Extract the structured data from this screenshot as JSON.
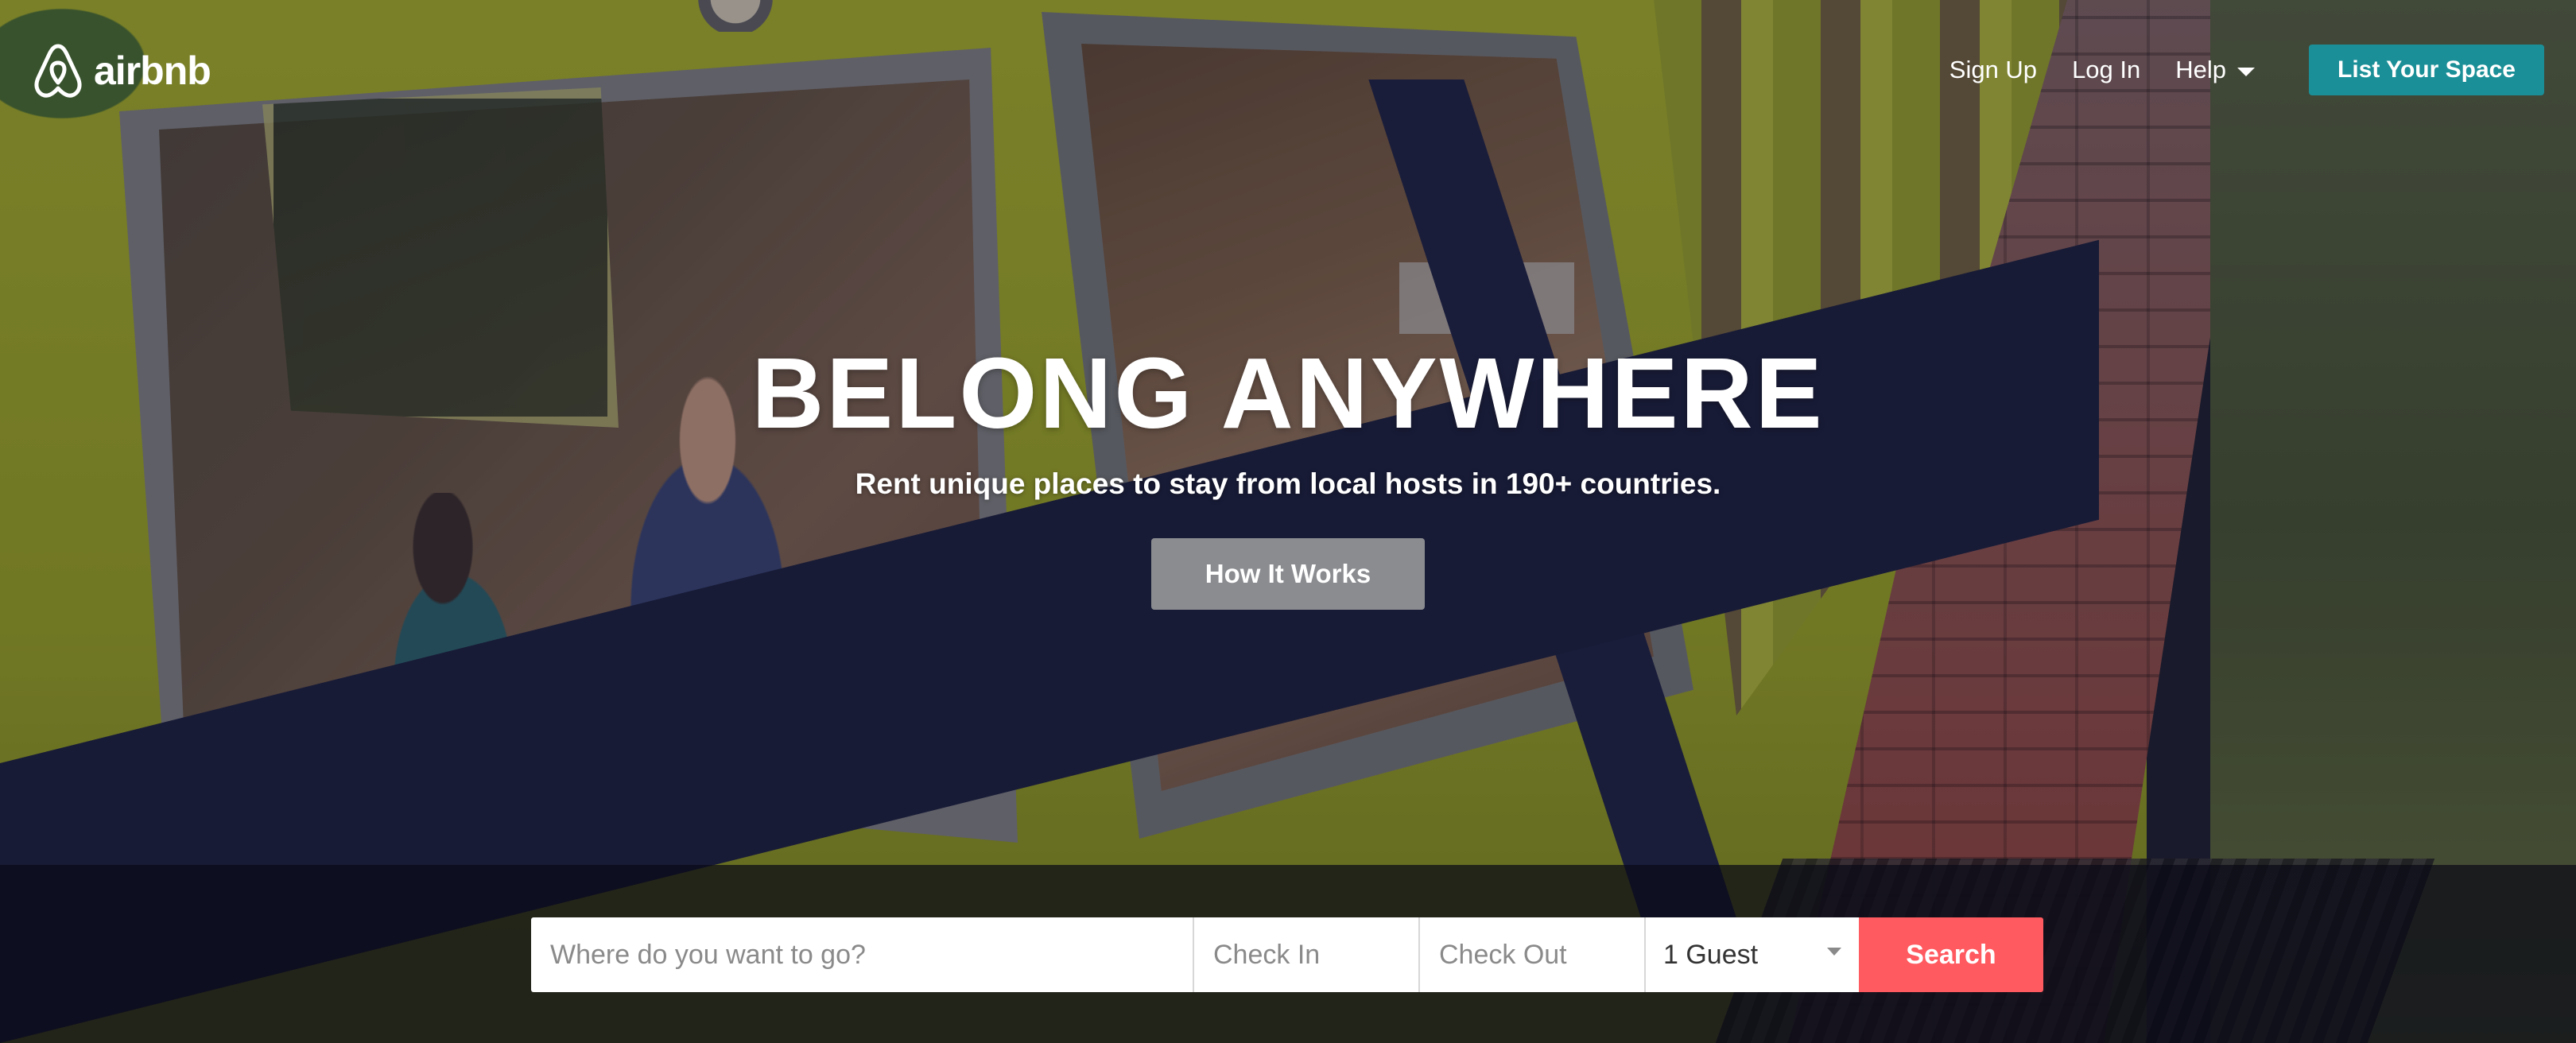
{
  "brand": {
    "logo_text": "airbnb"
  },
  "nav": {
    "sign_up": "Sign Up",
    "log_in": "Log In",
    "help": "Help",
    "list_space": "List Your Space"
  },
  "hero": {
    "headline": "BELONG ANYWHERE",
    "subline": "Rent unique places to stay from local hosts in 190+ countries.",
    "cta": "How It Works"
  },
  "search": {
    "where_placeholder": "Where do you want to go?",
    "check_in_placeholder": "Check In",
    "check_out_placeholder": "Check Out",
    "guests_value": "1 Guest",
    "button_label": "Search"
  },
  "colors": {
    "list_button": "#1b8f97",
    "search_button": "#ff5a5f",
    "text_light": "#ffffff"
  },
  "icons": {
    "logo": "airbnb-belo-icon",
    "help_caret": "chevron-down-icon",
    "guest_caret": "chevron-down-icon"
  }
}
